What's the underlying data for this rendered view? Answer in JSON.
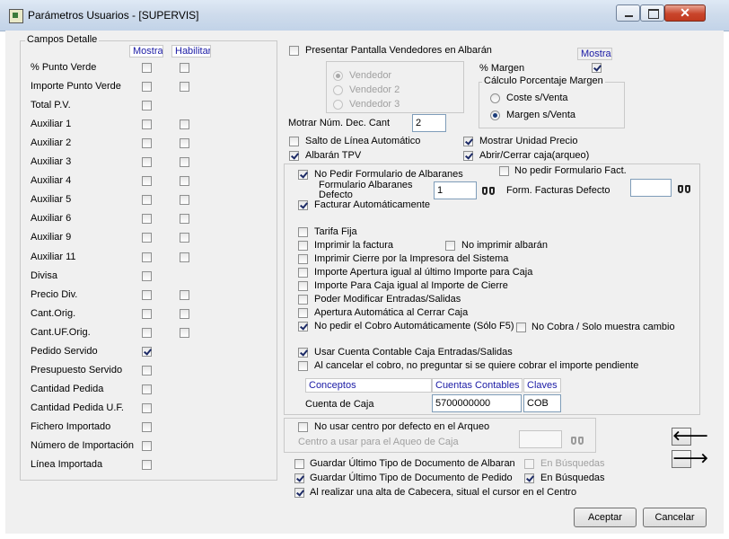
{
  "window": {
    "title": "Parámetros Usuarios - [SUPERVIS]",
    "controls": {
      "minimize_icon": "minimize-icon",
      "maximize_icon": "maximize-icon",
      "close_icon": "close-icon",
      "close_glyph": "✕"
    }
  },
  "campos": {
    "legend": "Campos Detalle",
    "col_mostrar": "Mostrar",
    "col_habilitar": "Habilitar",
    "rows": [
      {
        "label": "% Punto Verde",
        "mostrar": false,
        "habilitar": false
      },
      {
        "label": "Importe Punto Verde",
        "mostrar": false,
        "habilitar": false
      },
      {
        "label": "Total P.V.",
        "mostrar": false,
        "habilitar": null
      },
      {
        "label": "Auxiliar 1",
        "mostrar": false,
        "habilitar": false
      },
      {
        "label": "Auxiliar 2",
        "mostrar": false,
        "habilitar": false
      },
      {
        "label": "Auxiliar 3",
        "mostrar": false,
        "habilitar": false
      },
      {
        "label": "Auxiliar 4",
        "mostrar": false,
        "habilitar": false
      },
      {
        "label": "Auxiliar 5",
        "mostrar": false,
        "habilitar": false
      },
      {
        "label": "Auxiliar 6",
        "mostrar": false,
        "habilitar": false
      },
      {
        "label": "Auxiliar 9",
        "mostrar": false,
        "habilitar": false
      },
      {
        "label": "Auxiliar 11",
        "mostrar": false,
        "habilitar": false
      },
      {
        "label": "Divisa",
        "mostrar": false,
        "habilitar": null
      },
      {
        "label": "Precio Div.",
        "mostrar": false,
        "habilitar": false
      },
      {
        "label": "Cant.Orig.",
        "mostrar": false,
        "habilitar": false
      },
      {
        "label": "Cant.UF.Orig.",
        "mostrar": false,
        "habilitar": false
      },
      {
        "label": "Pedido Servido",
        "mostrar": true,
        "habilitar": null
      },
      {
        "label": "Presupuesto Servido",
        "mostrar": false,
        "habilitar": null
      },
      {
        "label": "Cantidad Pedida",
        "mostrar": false,
        "habilitar": null
      },
      {
        "label": "Cantidad Pedida U.F.",
        "mostrar": false,
        "habilitar": null
      },
      {
        "label": "Fichero Importado",
        "mostrar": false,
        "habilitar": null
      },
      {
        "label": "Número de Importación",
        "mostrar": false,
        "habilitar": null
      },
      {
        "label": "Línea Importada",
        "mostrar": false,
        "habilitar": null
      }
    ]
  },
  "vendedores": {
    "presentar_label": "Presentar Pantalla Vendedores en Albarán",
    "presentar_checked": false,
    "radios": [
      {
        "label": "Vendedor",
        "selected": true
      },
      {
        "label": "Vendedor 2",
        "selected": false
      },
      {
        "label": "Vendedor 3",
        "selected": false
      }
    ]
  },
  "margen": {
    "mostrar_header": "Mostrar",
    "label": "% Margen",
    "checked": true,
    "group_legend": "Cálculo Porcentaje Margen",
    "options": [
      {
        "label": "Coste s/Venta",
        "selected": false
      },
      {
        "label": "Margen s/Venta",
        "selected": true
      }
    ]
  },
  "decimales": {
    "label": "Motrar Núm. Dec. Cant",
    "value": "2"
  },
  "opciones": {
    "salto_linea": {
      "label": "Salto de Línea Automático",
      "checked": false
    },
    "albaran_tpv": {
      "label": "Albarán TPV",
      "checked": true
    },
    "mostrar_unidad_precio": {
      "label": "Mostrar Unidad Precio",
      "checked": true
    },
    "abrir_cerrar_caja": {
      "label": "Abrir/Cerrar caja(arqueo)",
      "checked": true
    }
  },
  "tpv": {
    "no_pedir_form_albaranes": {
      "label": "No Pedir Formulario de Albaranes",
      "checked": true
    },
    "no_pedir_form_fact": {
      "label": "No pedir Formulario Fact.",
      "checked": false
    },
    "form_albaranes_label": "Formulario Albaranes Defecto",
    "form_albaranes_value": "1",
    "form_facturas_label": "Form. Facturas Defecto",
    "form_facturas_value": "",
    "facturar_auto": {
      "label": "Facturar Automáticamente",
      "checked": true
    },
    "tarifa_fija": {
      "label": "Tarifa Fija",
      "checked": false
    },
    "imprimir_factura": {
      "label": "Imprimir la factura",
      "checked": false
    },
    "no_imprimir_albaran": {
      "label": "No imprimir albarán",
      "checked": false
    },
    "imprimir_cierre": {
      "label": "Imprimir Cierre por la Impresora del Sistema",
      "checked": false
    },
    "importe_apertura": {
      "label": "Importe Apertura igual al último Importe para Caja",
      "checked": false
    },
    "importe_para_caja": {
      "label": "Importe Para Caja igual al Importe de Cierre",
      "checked": false
    },
    "poder_modificar": {
      "label": "Poder Modificar Entradas/Salidas",
      "checked": false
    },
    "apertura_auto": {
      "label": "Apertura Automática al Cerrar Caja",
      "checked": false
    },
    "no_pedir_cobro": {
      "label": "No pedir el Cobro Automáticamente (Sólo F5)",
      "checked": true
    },
    "no_cobra": {
      "label": "No Cobra / Solo muestra cambio",
      "checked": false
    },
    "usar_cuenta": {
      "label": "Usar Cuenta Contable Caja Entradas/Salidas",
      "checked": true
    },
    "al_cancelar": {
      "label": "Al cancelar el cobro, no preguntar si se quiere cobrar el importe pendiente",
      "checked": false
    },
    "table": {
      "headers": [
        "Conceptos",
        "Cuentas Contables",
        "Claves ("
      ],
      "row": {
        "concepto": "Cuenta de Caja",
        "cuenta": "5700000000",
        "clave": "COB"
      }
    }
  },
  "arqueo": {
    "no_usar_centro": {
      "label": "No usar centro por defecto en el Arqueo",
      "checked": false
    },
    "centro_label": "Centro a usar para el Aqueo de Caja",
    "centro_value": ""
  },
  "guardar": {
    "tipo_albaran": {
      "label": "Guardar Último Tipo de Documento de Albaran",
      "checked": false
    },
    "en_busquedas_1": {
      "label": "En Búsquedas",
      "checked": false
    },
    "tipo_pedido": {
      "label": "Guardar Último Tipo de Documento de Pedido",
      "checked": true
    },
    "en_busquedas_2": {
      "label": "En Búsquedas",
      "checked": true
    },
    "alta_cabecera": {
      "label": "Al realizar una alta de Cabecera, situal el cursor en el Centro",
      "checked": true
    }
  },
  "nav": {
    "prev_glyph": "🡐",
    "next_glyph": "🡒",
    "prev_icon": "arrow-left-icon",
    "next_icon": "arrow-right-icon"
  },
  "buttons": {
    "aceptar": "Aceptar",
    "cancelar": "Cancelar"
  },
  "search_icon": "binoculars-icon"
}
